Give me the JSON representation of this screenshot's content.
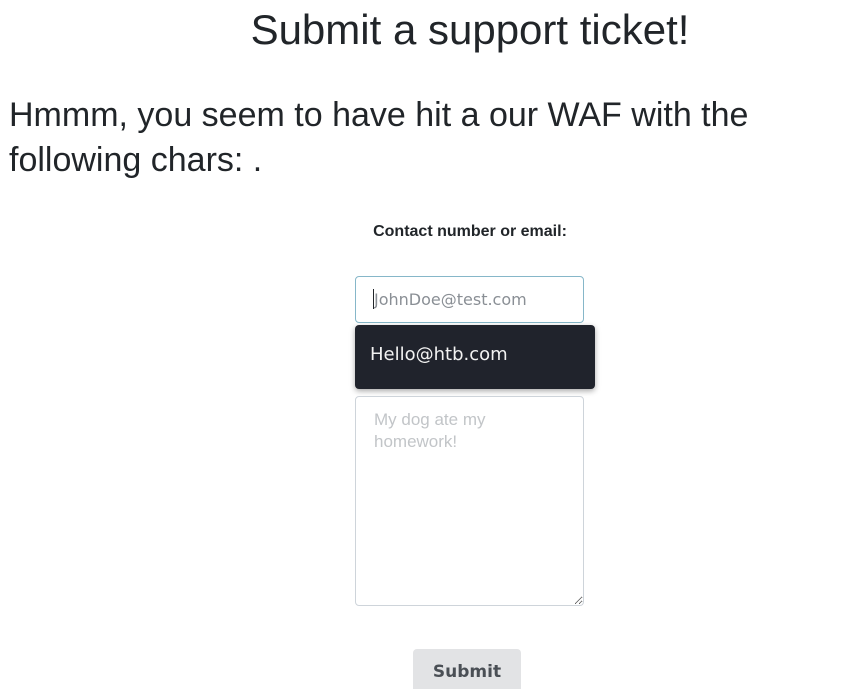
{
  "header": {
    "title": "Submit a support ticket!"
  },
  "waf": {
    "message": "Hmmm, you seem to have hit a our WAF with the following chars: ."
  },
  "form": {
    "contact_label": "Contact number or email:",
    "contact_input": {
      "value": "",
      "placeholder": "JohnDoe@test.com"
    },
    "autofill": {
      "options": [
        "Hello@htb.com"
      ]
    },
    "message_input": {
      "value": "",
      "placeholder": "My dog ate my homework!"
    },
    "submit_label": "Submit"
  }
}
